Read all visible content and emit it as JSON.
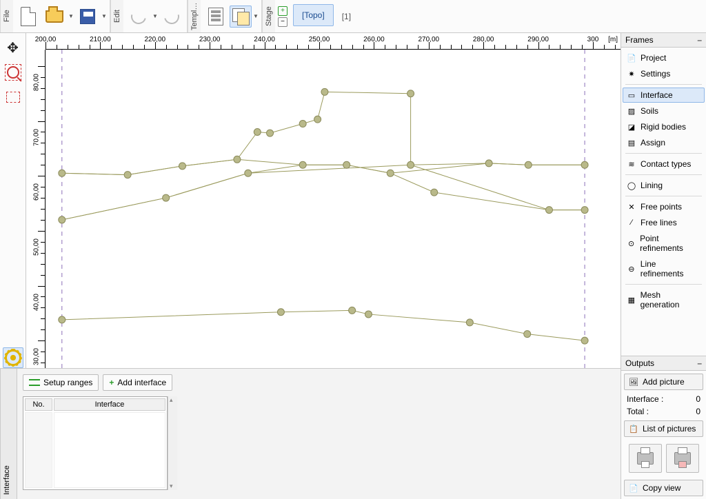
{
  "toolbar": {
    "file_label": "File",
    "edit_label": "Edit",
    "template_label": "Templ…",
    "stage_label": "Stage",
    "topo_label": "[Topo]",
    "one_label": "[1]"
  },
  "ruler": {
    "x_ticks": [
      "200,00",
      "210,00",
      "220,00",
      "230,00",
      "240,00",
      "250,00",
      "260,00",
      "270,00",
      "280,00",
      "290,00",
      "300"
    ],
    "y_ticks": [
      "80,00",
      "70,00",
      "60,00",
      "50,00",
      "40,00",
      "30,00"
    ],
    "unit": "[m]"
  },
  "frames": {
    "title": "Frames",
    "items": [
      {
        "label": "Project",
        "ico": "📄"
      },
      {
        "label": "Settings",
        "ico": "✷"
      }
    ],
    "items2": [
      {
        "label": "Interface",
        "ico": "▭",
        "sel": true
      },
      {
        "label": "Soils",
        "ico": "▨"
      },
      {
        "label": "Rigid bodies",
        "ico": "◪"
      },
      {
        "label": "Assign",
        "ico": "▤"
      }
    ],
    "items3": [
      {
        "label": "Contact types",
        "ico": "≋"
      }
    ],
    "items4": [
      {
        "label": "Lining",
        "ico": "◯"
      }
    ],
    "items5": [
      {
        "label": "Free points",
        "ico": "✕"
      },
      {
        "label": "Free lines",
        "ico": "∕"
      },
      {
        "label": "Point refinements",
        "ico": "⊙"
      },
      {
        "label": "Line refinements",
        "ico": "⊖"
      }
    ],
    "items6": [
      {
        "label": "Mesh generation",
        "ico": "▦"
      }
    ]
  },
  "outputs": {
    "title": "Outputs",
    "add_picture": "Add picture",
    "rows": [
      {
        "k": "Interface :",
        "v": "0"
      },
      {
        "k": "Total :",
        "v": "0"
      }
    ],
    "list_pictures": "List of pictures",
    "copy_view": "Copy view"
  },
  "bottom": {
    "title": "Interface",
    "setup_ranges": "Setup ranges",
    "add_interface": "Add interface",
    "cols": [
      "No.",
      "Interface"
    ]
  },
  "chart_data": {
    "type": "line",
    "xlim": [
      200,
      300
    ],
    "ylim": [
      25,
      83
    ],
    "bounds_x": [
      203,
      298.5
    ],
    "series": [
      {
        "name": "s1",
        "pts": [
          [
            203,
            60.5
          ],
          [
            215,
            60.2
          ],
          [
            225,
            61.8
          ],
          [
            235,
            63
          ],
          [
            238.7,
            68
          ],
          [
            241,
            67.8
          ],
          [
            247,
            69.5
          ],
          [
            249.7,
            70.3
          ],
          [
            251,
            75.3
          ],
          [
            266.7,
            75
          ],
          [
            266.7,
            62
          ],
          [
            281,
            62.3
          ],
          [
            288.2,
            62
          ],
          [
            298.5,
            62
          ]
        ]
      },
      {
        "name": "s2",
        "pts": [
          [
            203,
            60.5
          ],
          [
            215,
            60.2
          ],
          [
            225,
            61.8
          ],
          [
            235,
            63
          ],
          [
            247,
            62
          ],
          [
            255,
            62
          ],
          [
            263,
            60.5
          ],
          [
            281,
            62.3
          ],
          [
            288.2,
            62
          ],
          [
            298.5,
            62
          ]
        ]
      },
      {
        "name": "s3",
        "pts": [
          [
            203,
            52
          ],
          [
            222,
            56
          ],
          [
            237,
            60.5
          ],
          [
            247,
            62
          ],
          [
            255,
            62
          ],
          [
            263,
            60.5
          ],
          [
            271,
            57
          ],
          [
            292,
            53.8
          ],
          [
            298.5,
            53.8
          ]
        ]
      },
      {
        "name": "s4",
        "pts": [
          [
            203,
            52
          ],
          [
            222,
            56
          ],
          [
            237,
            60.5
          ],
          [
            266.7,
            62
          ],
          [
            292,
            53.8
          ],
          [
            298.5,
            53.8
          ]
        ]
      },
      {
        "name": "s5",
        "pts": [
          [
            203,
            33.8
          ],
          [
            243,
            35.2
          ],
          [
            256,
            35.5
          ],
          [
            259,
            34.8
          ],
          [
            277.5,
            33.3
          ],
          [
            288,
            31.2
          ],
          [
            298.5,
            30
          ]
        ]
      }
    ]
  }
}
